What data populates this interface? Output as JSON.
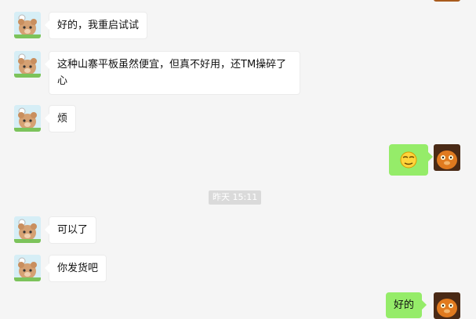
{
  "timestamp": "昨天 15:11",
  "messages": [
    {
      "text": "好的，我重启试试"
    },
    {
      "text": "这种山寨平板虽然便宜，但真不好用，还TM操碎了心"
    },
    {
      "text": "烦"
    },
    {
      "emoji": "smug-emoji"
    },
    {
      "text": "可以了"
    },
    {
      "text": "你发货吧"
    },
    {
      "text": "好的"
    }
  ],
  "avatars": {
    "contact": "bear-avatar",
    "self": "cat-avatar"
  },
  "colors": {
    "background": "#f5f5f5",
    "incoming_bubble": "#ffffff",
    "outgoing_bubble": "#95ec69",
    "timestamp_bg": "#dadada"
  }
}
